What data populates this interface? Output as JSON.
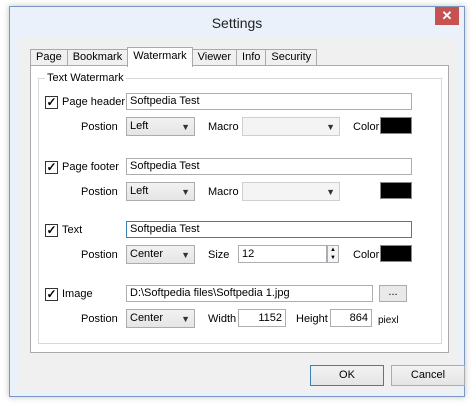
{
  "window": {
    "title": "Settings",
    "close_glyph": "✕"
  },
  "tabs": [
    "Page",
    "Bookmark",
    "Watermark",
    "Viewer",
    "Info",
    "Security"
  ],
  "group_title": "Text Watermark",
  "header": {
    "label": "Page header",
    "checked": true,
    "value": "Softpedia Test",
    "position_label": "Postion",
    "position": "Left",
    "macro_label": "Macro",
    "macro": "",
    "color_label": "Color",
    "color": "#000000"
  },
  "footer": {
    "label": "Page footer",
    "checked": true,
    "value": "Softpedia Test",
    "position_label": "Postion",
    "position": "Left",
    "macro_label": "Macro",
    "macro": "",
    "color": "#000000"
  },
  "text": {
    "label": "Text",
    "checked": true,
    "value": "Softpedia Test",
    "position_label": "Postion",
    "position": "Center",
    "size_label": "Size",
    "size": "12",
    "color_label": "Color",
    "color": "#000000"
  },
  "image": {
    "label": "Image",
    "checked": true,
    "path": "D:\\Softpedia files\\Softpedia 1.jpg",
    "browse_label": "...",
    "position_label": "Postion",
    "position": "Center",
    "width_label": "Width",
    "width": "1152",
    "height_label": "Height",
    "height": "864",
    "unit": "piexl"
  },
  "buttons": {
    "ok": "OK",
    "cancel": "Cancel"
  },
  "check_glyph": "✓"
}
